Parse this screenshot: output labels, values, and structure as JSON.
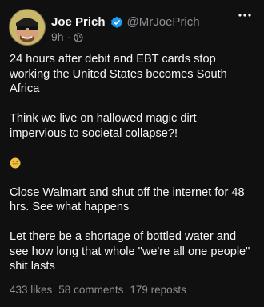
{
  "post": {
    "author": {
      "display_name": "Joe Prich",
      "handle": "@MrJoePrich",
      "verified": true,
      "avatar_icon": "avatar-sunglasses-man"
    },
    "meta": {
      "time": "9h",
      "separator": "·",
      "visibility_icon": "globe-icon"
    },
    "body": {
      "p1": "24 hours after debit and EBT cards stop working the United States becomes South Africa",
      "p2": "Think we live on hallowed magic dirt impervious to societal collapse?!",
      "emoji_icon": "grinning-sweat-emoji",
      "p3": "Close Walmart and shut off the internet for 48 hrs. See what happens",
      "p4": "Let there be a shortage of bottled water and see how long that whole \"we're all one people\" shit lasts"
    },
    "stats": {
      "likes": "433 likes",
      "comments": "58 comments",
      "reposts": "179 reposts"
    },
    "colors": {
      "background": "#101010",
      "text": "#f3f5f7",
      "muted": "#8c8f94",
      "verified": "#1d9bf0"
    }
  }
}
